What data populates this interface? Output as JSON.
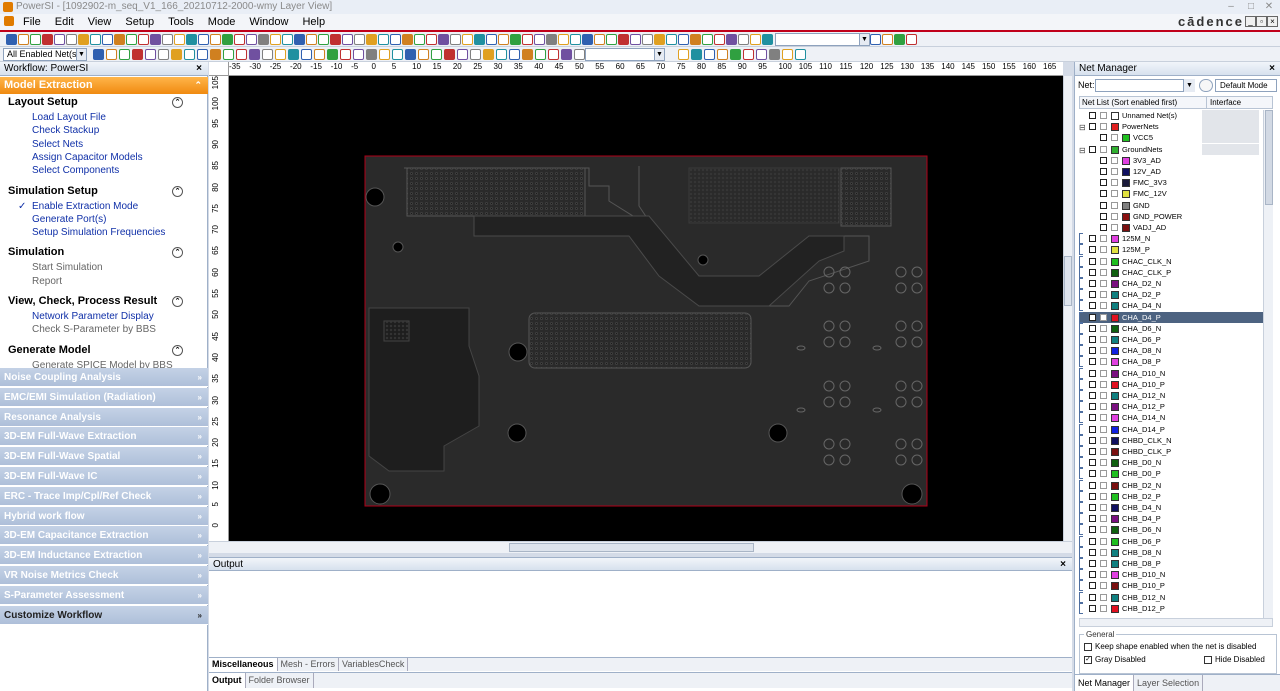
{
  "window": {
    "title": "PowerSI - [1092902-m_seq_V1_166_20210712-2000-wmy Layer View]",
    "brand": "cādence",
    "controls": {
      "minimize": "–",
      "maximize": "□",
      "close": "✕"
    }
  },
  "menu": [
    "File",
    "Edit",
    "View",
    "Setup",
    "Tools",
    "Mode",
    "Window",
    "Help"
  ],
  "toolbar": {
    "net_filter_value": "All Enabled Net(s)"
  },
  "workflow": {
    "header": "Workflow: PowerSI",
    "close": "×",
    "active_group": "Model Extraction",
    "sections": [
      {
        "title": "Layout Setup",
        "items": [
          {
            "label": "Load Layout File",
            "enabled": true
          },
          {
            "label": "Check Stackup",
            "enabled": true
          },
          {
            "label": "Select Nets",
            "enabled": true
          },
          {
            "label": "Assign Capacitor Models",
            "enabled": true
          },
          {
            "label": "Select Components",
            "enabled": true
          }
        ]
      },
      {
        "title": "Simulation Setup",
        "items": [
          {
            "label": "Enable Extraction Mode",
            "enabled": true,
            "checked": true
          },
          {
            "label": "Generate Port(s)",
            "enabled": true
          },
          {
            "label": "Setup Simulation Frequencies",
            "enabled": true
          }
        ]
      },
      {
        "title": "Simulation",
        "items": [
          {
            "label": "Start Simulation",
            "enabled": false
          },
          {
            "label": "Report",
            "enabled": false
          }
        ]
      },
      {
        "title": "View, Check, Process Result",
        "items": [
          {
            "label": "Network Parameter Display",
            "enabled": true
          },
          {
            "label": "Check S-Parameter by BBS",
            "enabled": false
          }
        ]
      },
      {
        "title": "Generate Model",
        "items": [
          {
            "label": "Generate SPICE Model by BBS",
            "enabled": false
          }
        ]
      }
    ],
    "collapsed_groups": [
      "Noise Coupling Analysis",
      "EMC/EMI Simulation (Radiation)",
      "Resonance Analysis",
      "3D-EM Full-Wave Extraction",
      "3D-EM Full-Wave Spatial",
      "3D-EM Full-Wave IC",
      "ERC - Trace Imp/Cpl/Ref Check",
      "Hybrid work flow",
      "3D-EM Capacitance Extraction",
      "3D-EM Inductance Extraction",
      "VR Noise Metrics Check",
      "S-Parameter Assessment",
      "Customize Workflow"
    ]
  },
  "ruler": {
    "h_ticks": [
      "-35",
      "-30",
      "-25",
      "-20",
      "-15",
      "-10",
      "-5",
      "0",
      "5",
      "10",
      "15",
      "20",
      "25",
      "30",
      "35",
      "40",
      "45",
      "50",
      "55",
      "60",
      "65",
      "70",
      "75",
      "80",
      "85",
      "90",
      "95",
      "100",
      "105",
      "110",
      "115",
      "120",
      "125",
      "130",
      "135",
      "140",
      "145",
      "150",
      "155",
      "160",
      "165"
    ],
    "v_ticks": [
      "105",
      "100",
      "95",
      "90",
      "85",
      "80",
      "75",
      "70",
      "65",
      "60",
      "55",
      "50",
      "45",
      "40",
      "35",
      "30",
      "25",
      "20",
      "15",
      "10",
      "5",
      "0"
    ]
  },
  "output": {
    "title": "Output",
    "close": "×",
    "tabs_upper": [
      "Miscellaneous",
      "Mesh - Errors",
      "VariablesCheck"
    ],
    "tabs_lower": [
      "Output",
      "Folder Browser"
    ]
  },
  "net_manager": {
    "title": "Net Manager",
    "close": "×",
    "net_label": "Net:",
    "mode": "Default Mode",
    "col_netlist": "Net List (Sort enabled first)",
    "col_interface": "Interface",
    "nets": [
      {
        "name": "Unnamed Net(s)",
        "color": "#ffffff",
        "indent": 0,
        "kind": "group"
      },
      {
        "name": "PowerNets",
        "color": "#e02020",
        "indent": 0,
        "kind": "group",
        "expand": "-"
      },
      {
        "name": "VCC5",
        "color": "#20c020",
        "indent": 1,
        "kind": "child"
      },
      {
        "name": "GroundNets",
        "color": "#30b030",
        "indent": 0,
        "kind": "group",
        "expand": "-"
      },
      {
        "name": "3V3_AD",
        "color": "#e040e0",
        "indent": 1,
        "kind": "child"
      },
      {
        "name": "12V_AD",
        "color": "#101060",
        "indent": 1,
        "kind": "child"
      },
      {
        "name": "FMC_3V3",
        "color": "#1a1a3a",
        "indent": 1,
        "kind": "child"
      },
      {
        "name": "FMC_12V",
        "color": "#e0e040",
        "indent": 1,
        "kind": "child"
      },
      {
        "name": "GND",
        "color": "#808080",
        "indent": 1,
        "kind": "child"
      },
      {
        "name": "GND_POWER",
        "color": "#8a1010",
        "indent": 1,
        "kind": "child"
      },
      {
        "name": "VADJ_AD",
        "color": "#7a1010",
        "indent": 1,
        "kind": "child"
      },
      {
        "name": "125M_N",
        "color": "#e040e0",
        "indent": 0,
        "kind": "net"
      },
      {
        "name": "125M_P",
        "color": "#e0e040",
        "indent": 0,
        "kind": "net"
      },
      {
        "name": "CHAC_CLK_N",
        "color": "#20c020",
        "indent": 0,
        "kind": "net"
      },
      {
        "name": "CHAC_CLK_P",
        "color": "#106010",
        "indent": 0,
        "kind": "net"
      },
      {
        "name": "CHA_D2_N",
        "color": "#7a1080",
        "indent": 0,
        "kind": "net"
      },
      {
        "name": "CHA_D2_P",
        "color": "#108080",
        "indent": 0,
        "kind": "net"
      },
      {
        "name": "CHA_D4_N",
        "color": "#108080",
        "indent": 0,
        "kind": "net"
      },
      {
        "name": "CHA_D4_P",
        "color": "#e01020",
        "indent": 0,
        "kind": "net",
        "selected": true
      },
      {
        "name": "CHA_D6_N",
        "color": "#106010",
        "indent": 0,
        "kind": "net"
      },
      {
        "name": "CHA_D6_P",
        "color": "#108080",
        "indent": 0,
        "kind": "net"
      },
      {
        "name": "CHA_D8_N",
        "color": "#1020e0",
        "indent": 0,
        "kind": "net"
      },
      {
        "name": "CHA_D8_P",
        "color": "#e040e0",
        "indent": 0,
        "kind": "net"
      },
      {
        "name": "CHA_D10_N",
        "color": "#7a1080",
        "indent": 0,
        "kind": "net"
      },
      {
        "name": "CHA_D10_P",
        "color": "#e01020",
        "indent": 0,
        "kind": "net"
      },
      {
        "name": "CHA_D12_N",
        "color": "#108080",
        "indent": 0,
        "kind": "net"
      },
      {
        "name": "CHA_D12_P",
        "color": "#7a1080",
        "indent": 0,
        "kind": "net"
      },
      {
        "name": "CHA_D14_N",
        "color": "#e040e0",
        "indent": 0,
        "kind": "net"
      },
      {
        "name": "CHA_D14_P",
        "color": "#1020e0",
        "indent": 0,
        "kind": "net"
      },
      {
        "name": "CHBD_CLK_N",
        "color": "#101060",
        "indent": 0,
        "kind": "net"
      },
      {
        "name": "CHBD_CLK_P",
        "color": "#7a1010",
        "indent": 0,
        "kind": "net"
      },
      {
        "name": "CHB_D0_N",
        "color": "#106010",
        "indent": 0,
        "kind": "net"
      },
      {
        "name": "CHB_D0_P",
        "color": "#20c020",
        "indent": 0,
        "kind": "net"
      },
      {
        "name": "CHB_D2_N",
        "color": "#7a1010",
        "indent": 0,
        "kind": "net"
      },
      {
        "name": "CHB_D2_P",
        "color": "#20c020",
        "indent": 0,
        "kind": "net"
      },
      {
        "name": "CHB_D4_N",
        "color": "#101060",
        "indent": 0,
        "kind": "net"
      },
      {
        "name": "CHB_D4_P",
        "color": "#7a1080",
        "indent": 0,
        "kind": "net"
      },
      {
        "name": "CHB_D6_N",
        "color": "#106010",
        "indent": 0,
        "kind": "net"
      },
      {
        "name": "CHB_D6_P",
        "color": "#20c020",
        "indent": 0,
        "kind": "net"
      },
      {
        "name": "CHB_D8_N",
        "color": "#108080",
        "indent": 0,
        "kind": "net"
      },
      {
        "name": "CHB_D8_P",
        "color": "#108080",
        "indent": 0,
        "kind": "net"
      },
      {
        "name": "CHB_D10_N",
        "color": "#e040e0",
        "indent": 0,
        "kind": "net"
      },
      {
        "name": "CHB_D10_P",
        "color": "#7a1010",
        "indent": 0,
        "kind": "net"
      },
      {
        "name": "CHB_D12_N",
        "color": "#108080",
        "indent": 0,
        "kind": "net"
      },
      {
        "name": "CHB_D12_P",
        "color": "#e01020",
        "indent": 0,
        "kind": "net"
      }
    ],
    "general": {
      "title": "General",
      "opt1": {
        "label": "Keep shape enabled when the net is disabled",
        "checked": false
      },
      "opt2": {
        "label": "Gray Disabled",
        "checked": true
      },
      "opt3": {
        "label": "Hide Disabled",
        "checked": false
      }
    },
    "tabs": [
      "Net Manager",
      "Layer Selection"
    ]
  },
  "colors": {
    "accent": "#f08a10",
    "board_outline": "#c00020",
    "selection": "#4d6381"
  }
}
